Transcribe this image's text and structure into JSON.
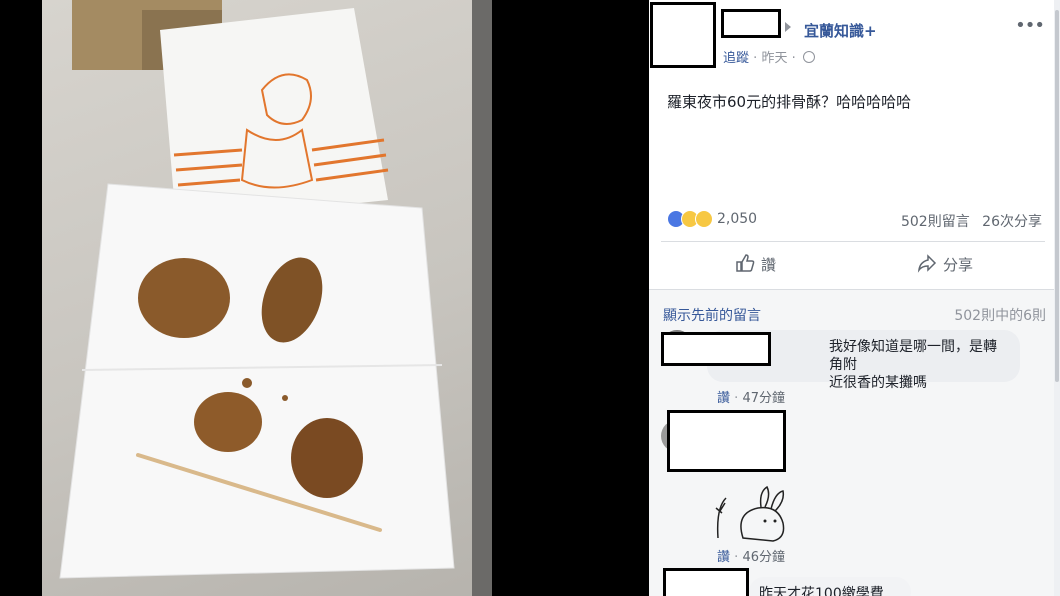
{
  "post": {
    "page_name": "宜蘭知識+",
    "follow_label": "追蹤",
    "time": "昨天",
    "separator": "·",
    "text": "羅東夜市60元的排骨酥？哈哈哈哈哈",
    "more_label": "•••"
  },
  "stats": {
    "reaction_count": "2,050",
    "comments": "502則留言",
    "shares": "26次分享"
  },
  "actions": {
    "like_label": "讚",
    "share_label": "分享"
  },
  "comments_header": {
    "show_previous": "顯示先前的留言",
    "count": "502則中的6則"
  },
  "comments": [
    {
      "text_line1": "我好像知道是哪一間，是轉角附",
      "text_line2": "近很香的某攤嗎",
      "like": "讚",
      "time": "47分鐘"
    },
    {
      "like": "讚",
      "time": "46分鐘"
    },
    {
      "text": "昨天才花100繳學費"
    }
  ],
  "colors": {
    "link": "#365899",
    "secondary_text": "#90949c",
    "like_blue": "#4a77e3"
  }
}
